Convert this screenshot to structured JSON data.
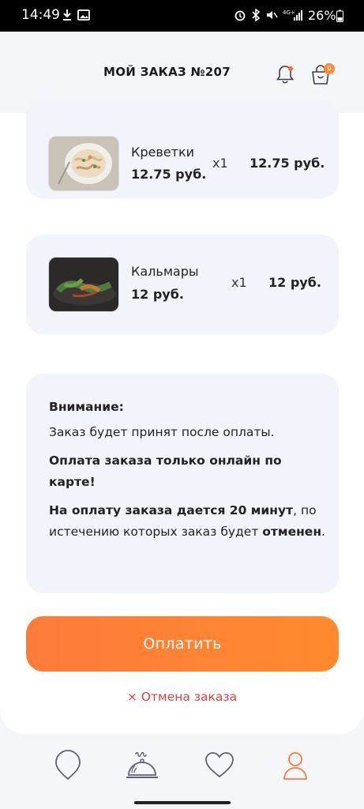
{
  "status": {
    "time": "14:49",
    "battery": "26%"
  },
  "header": {
    "title": "МОЙ ЗАКАЗ №207",
    "cart_count": "0"
  },
  "items": [
    {
      "name": "Креветки",
      "price": "12.75 руб.",
      "qty": "x1",
      "total": "12.75 руб."
    },
    {
      "name": "Кальмары",
      "price": "12 руб.",
      "qty": "x1",
      "total": "12 руб."
    }
  ],
  "notice": {
    "heading": "Внимание:",
    "line1": "Заказ будет принят после оплаты.",
    "line2": "Оплата заказа только онлайн по карте!",
    "line3_bold": "На оплату заказа дается 20 минут",
    "line3_mid": ", по истечению которых заказ будет ",
    "line3_bold2": "отменен",
    "line3_end": "."
  },
  "actions": {
    "pay_label": "Оплатить",
    "cancel_label": "Отмена заказа",
    "cancel_icon": "×"
  },
  "colors": {
    "accent": "#ff8a2e",
    "cancel": "#e34040"
  },
  "tabs": [
    {
      "icon": "map-pin-icon"
    },
    {
      "icon": "cloche-icon"
    },
    {
      "icon": "heart-icon"
    },
    {
      "icon": "user-icon",
      "active": true
    }
  ]
}
